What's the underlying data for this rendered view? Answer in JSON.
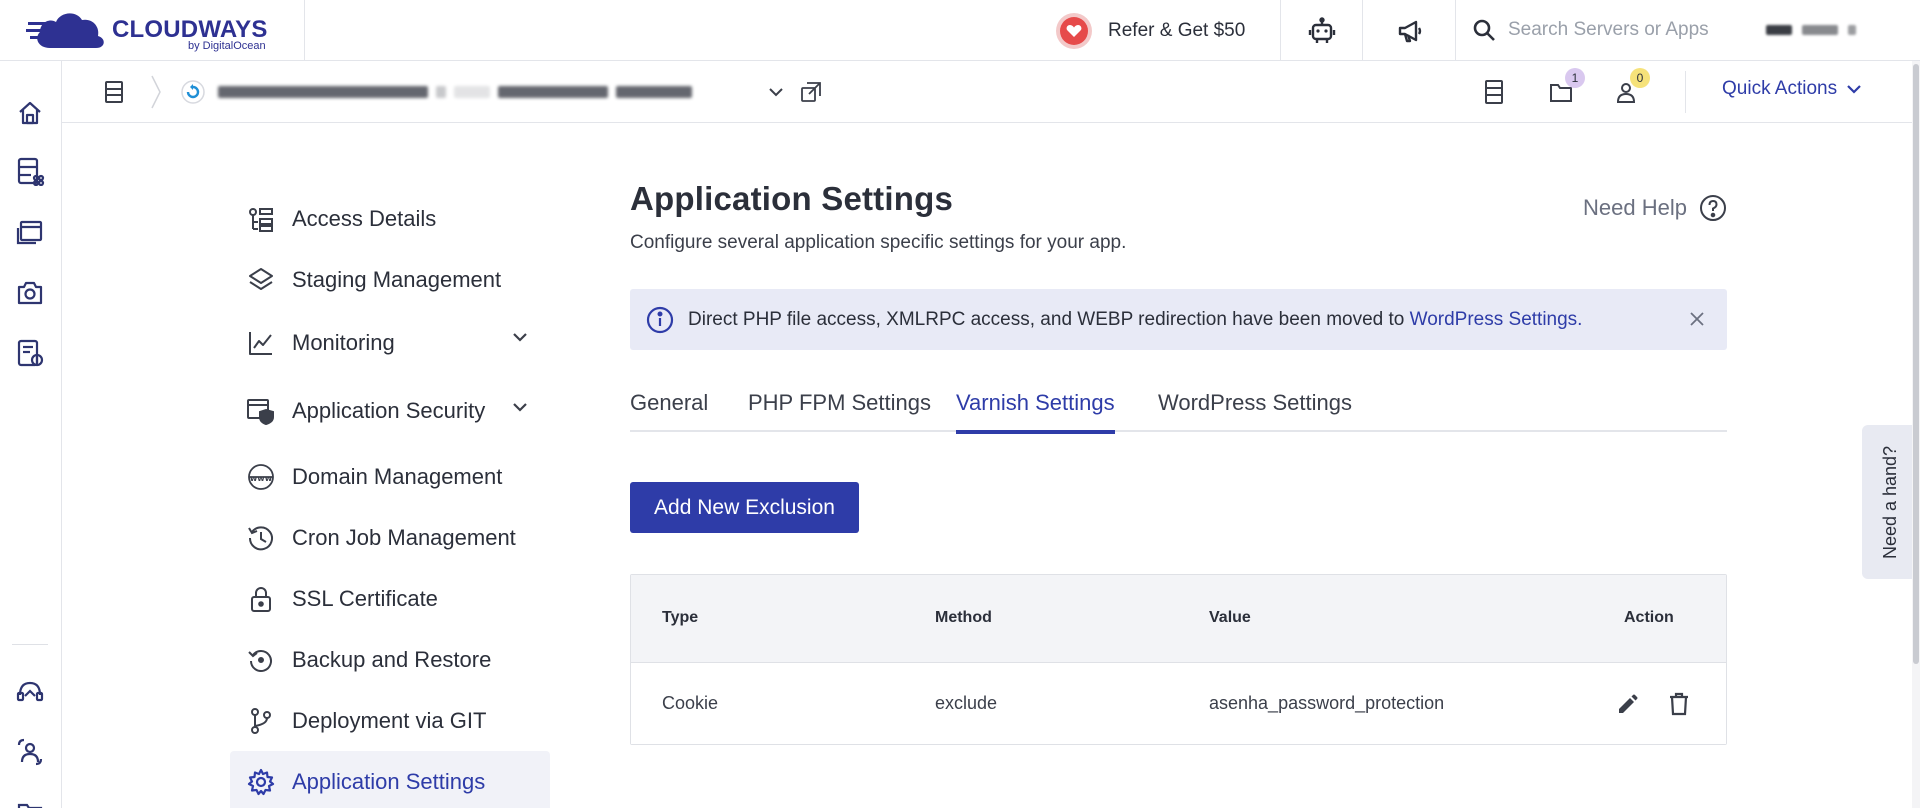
{
  "brand": {
    "name": "CLOUDWAYS",
    "sub": "by DigitalOcean"
  },
  "topbar": {
    "refer_label": "Refer & Get $50",
    "search_placeholder": "Search Servers or Apps"
  },
  "subheader": {
    "notifications_count": "1",
    "team_count": "0",
    "quick_actions_label": "Quick Actions"
  },
  "settings_nav": {
    "items": [
      {
        "label": "Access Details"
      },
      {
        "label": "Staging Management"
      },
      {
        "label": "Monitoring"
      },
      {
        "label": "Application Security"
      },
      {
        "label": "Domain Management"
      },
      {
        "label": "Cron Job Management"
      },
      {
        "label": "SSL Certificate"
      },
      {
        "label": "Backup and Restore"
      },
      {
        "label": "Deployment via GIT"
      },
      {
        "label": "Application Settings"
      }
    ],
    "active_index": 9
  },
  "main": {
    "title": "Application Settings",
    "subtitle": "Configure several application specific settings for your app.",
    "help_label": "Need Help",
    "notice_text": "Direct PHP file access, XMLRPC access, and WEBP redirection have been moved to",
    "notice_link": "WordPress Settings.",
    "tabs": [
      {
        "label": "General"
      },
      {
        "label": "PHP FPM Settings"
      },
      {
        "label": "Varnish Settings"
      },
      {
        "label": "WordPress Settings"
      }
    ],
    "active_tab": 2,
    "add_button_label": "Add New Exclusion",
    "table": {
      "headers": {
        "type": "Type",
        "method": "Method",
        "value": "Value",
        "action": "Action"
      },
      "rows": [
        {
          "type": "Cookie",
          "method": "exclude",
          "value": "asenha_password_protection"
        }
      ]
    }
  },
  "need_hand_label": "Need a hand?",
  "colors": {
    "accent": "#2e3ca8",
    "notice_bg": "#e8eaf6",
    "heart": "#e64a4a"
  }
}
